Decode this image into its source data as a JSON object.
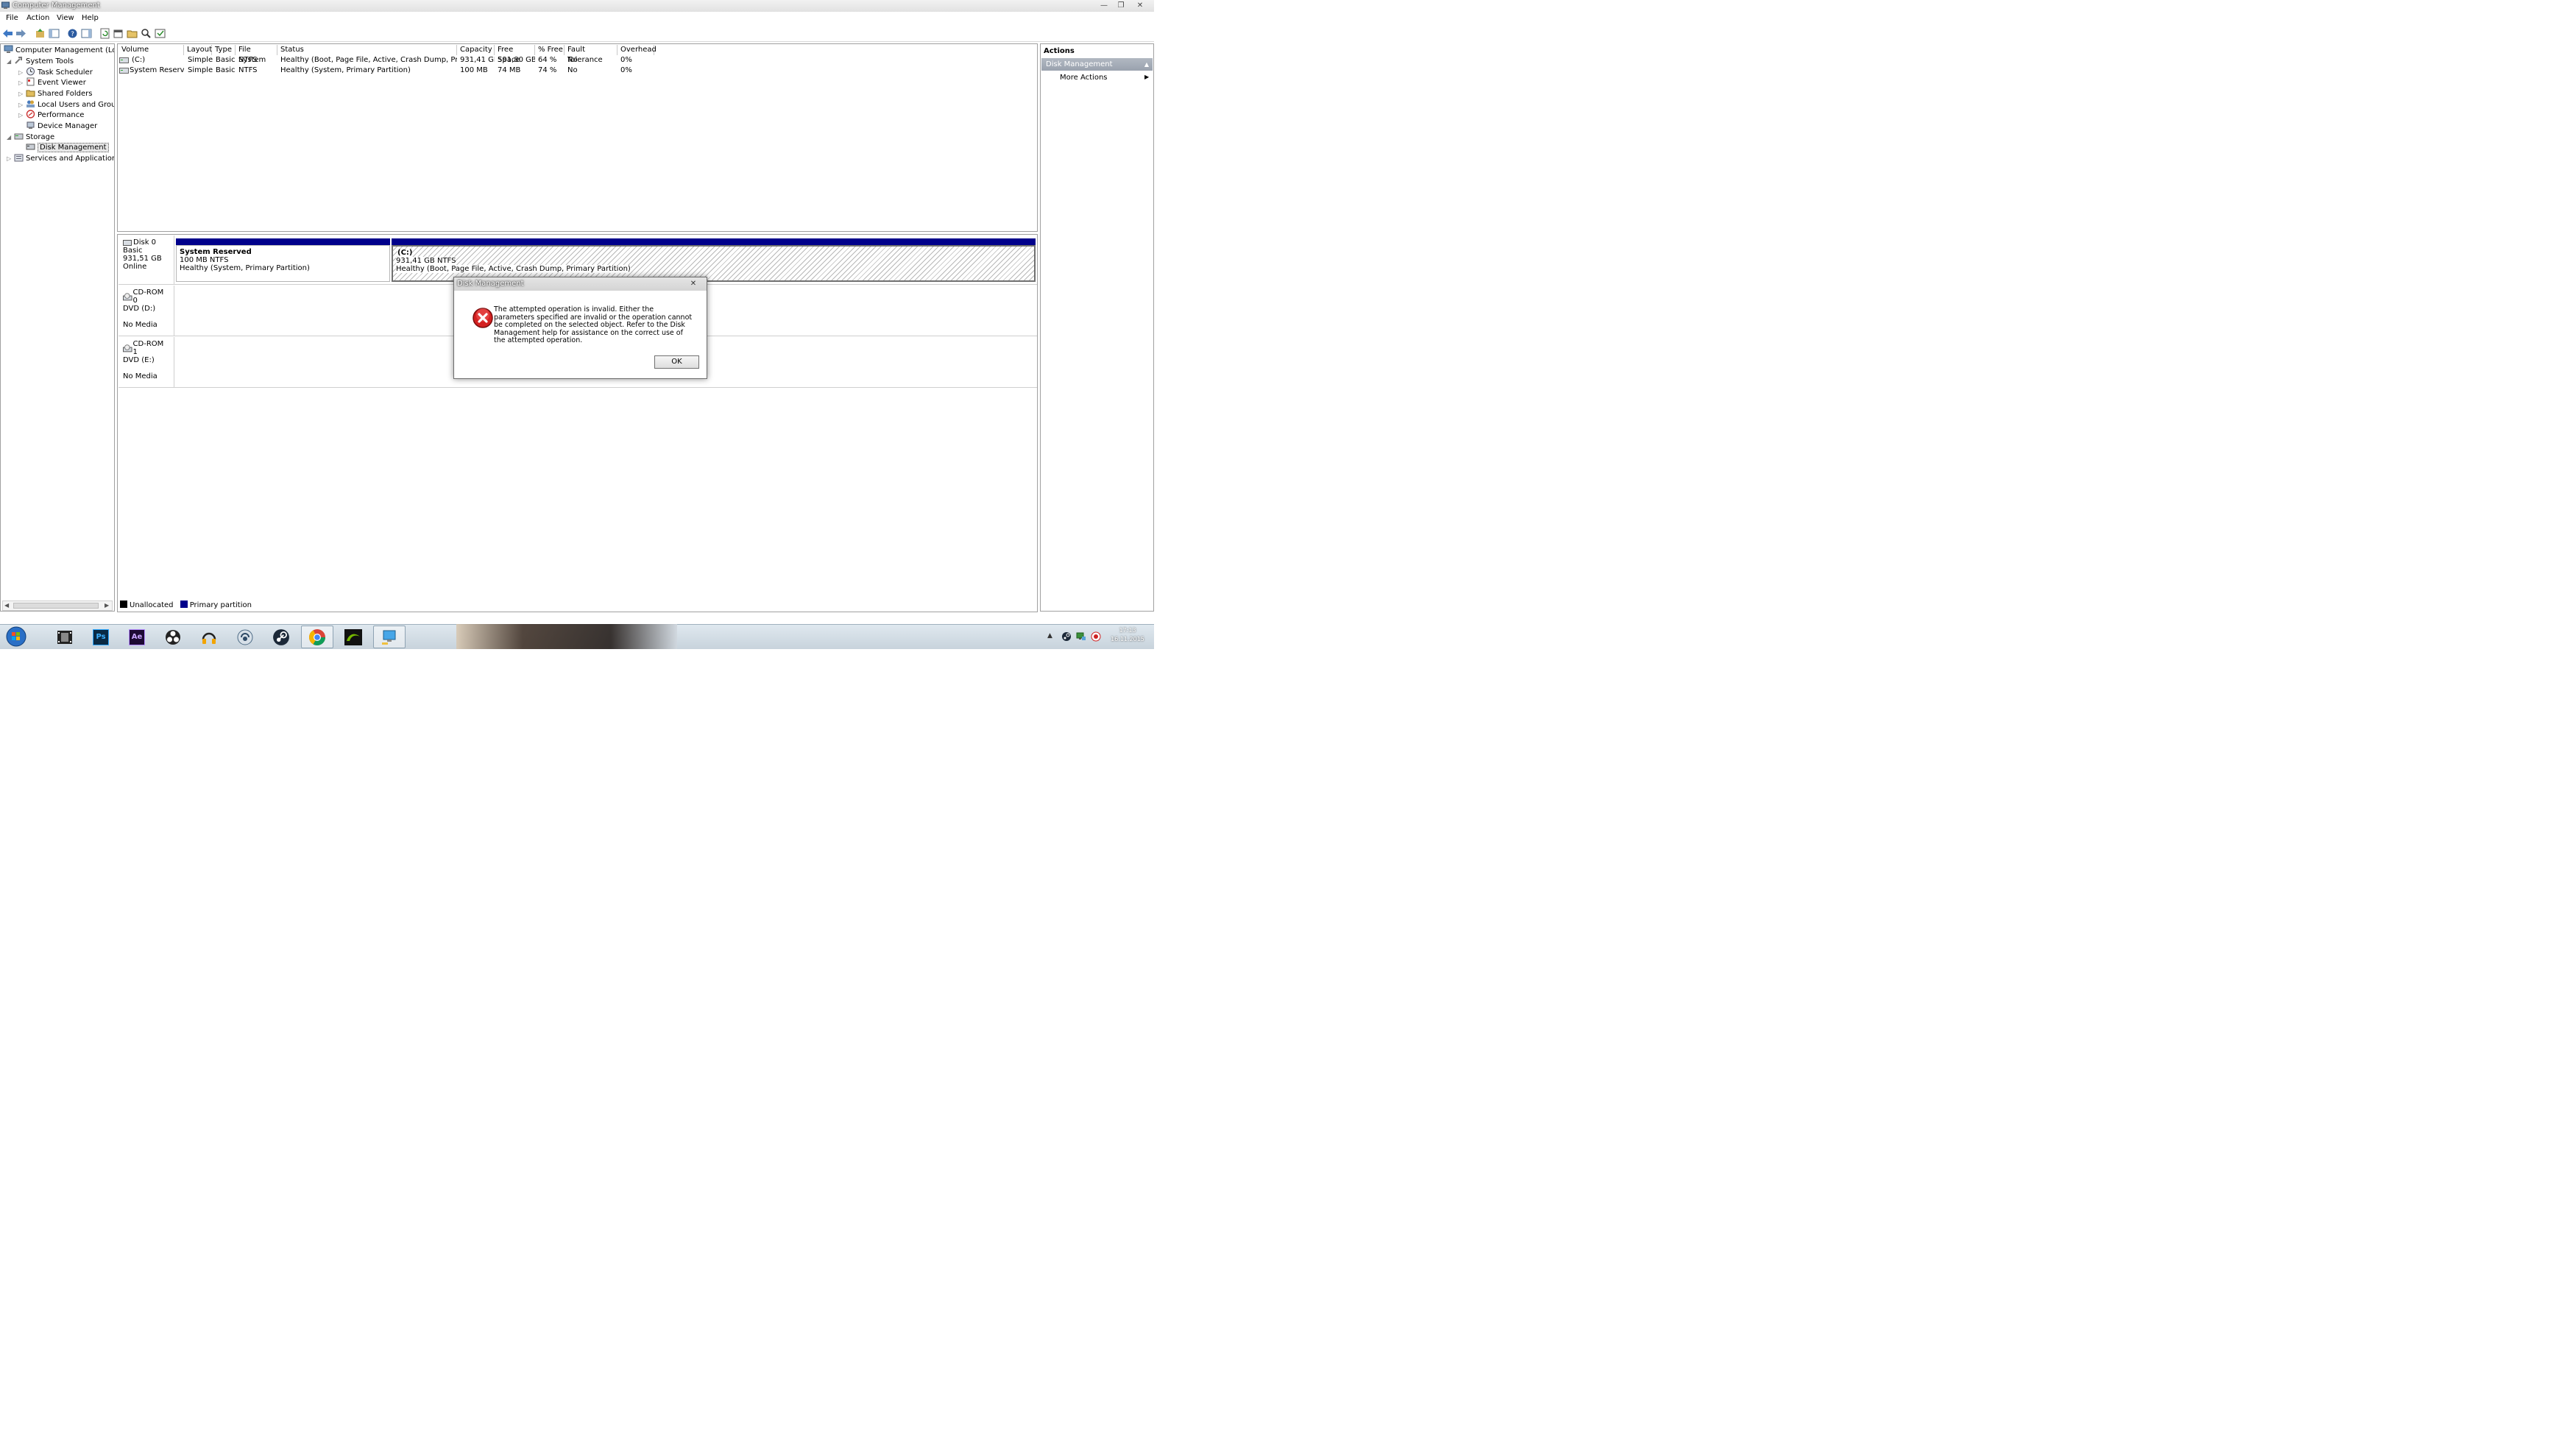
{
  "window": {
    "title": "Computer Management",
    "min": "—",
    "max": "❐",
    "close": "✕"
  },
  "menu": [
    "File",
    "Action",
    "View",
    "Help"
  ],
  "tree": {
    "root": "Computer Management (Local",
    "system_tools": "System Tools",
    "task_scheduler": "Task Scheduler",
    "event_viewer": "Event Viewer",
    "shared_folders": "Shared Folders",
    "local_users": "Local Users and Groups",
    "performance": "Performance",
    "device_manager": "Device Manager",
    "storage": "Storage",
    "disk_management": "Disk Management",
    "services": "Services and Applications"
  },
  "volume_table": {
    "columns": [
      "Volume",
      "Layout",
      "Type",
      "File System",
      "Status",
      "Capacity",
      "Free Space",
      "% Free",
      "Fault Tolerance",
      "Overhead"
    ],
    "rows": [
      [
        "(C:)",
        "Simple",
        "Basic",
        "NTFS",
        "Healthy (Boot, Page File, Active, Crash Dump, Primary ...",
        "931,41 GB",
        "591,80 GB",
        "64 %",
        "No",
        "0%"
      ],
      [
        "System Reserved",
        "Simple",
        "Basic",
        "NTFS",
        "Healthy (System, Primary Partition)",
        "100 MB",
        "74 MB",
        "74 %",
        "No",
        "0%"
      ]
    ]
  },
  "disks": {
    "disk0": {
      "name": "Disk 0",
      "type": "Basic",
      "size": "931,51 GB",
      "state": "Online"
    },
    "part_sysres": {
      "name": "System Reserved",
      "size": "100 MB NTFS",
      "status": "Healthy (System, Primary Partition)"
    },
    "part_c": {
      "name": "(C:)",
      "size": "931,41 GB NTFS",
      "status": "Healthy (Boot, Page File, Active, Crash Dump, Primary Partition)"
    },
    "cdrom0": {
      "name": "CD-ROM 0",
      "drive": "DVD (D:)",
      "media": "No Media"
    },
    "cdrom1": {
      "name": "CD-ROM 1",
      "drive": "DVD (E:)",
      "media": "No Media"
    }
  },
  "legend": {
    "unallocated": "Unallocated",
    "primary": "Primary partition"
  },
  "colors": {
    "primary_partition": "#00008b",
    "unallocated": "#000000"
  },
  "actions": {
    "title": "Actions",
    "section": "Disk Management",
    "more": "More Actions"
  },
  "dialog": {
    "title": "Disk Management",
    "message": "The attempted operation is invalid.  Either the parameters specified are invalid or the operation cannot be completed on the selected object.  Refer to the Disk Management help for assistance on the correct use of the attempted operation.",
    "ok": "OK",
    "close": "✕"
  },
  "taskbar": {
    "apps": [
      "Video Editor",
      "Ps",
      "Ae",
      "OBS",
      "Headphones",
      "TeamSpeak",
      "Steam",
      "Chrome",
      "NVIDIA",
      "Computer Management"
    ],
    "clock_time": "17:13",
    "clock_date": "16.11.2015"
  }
}
